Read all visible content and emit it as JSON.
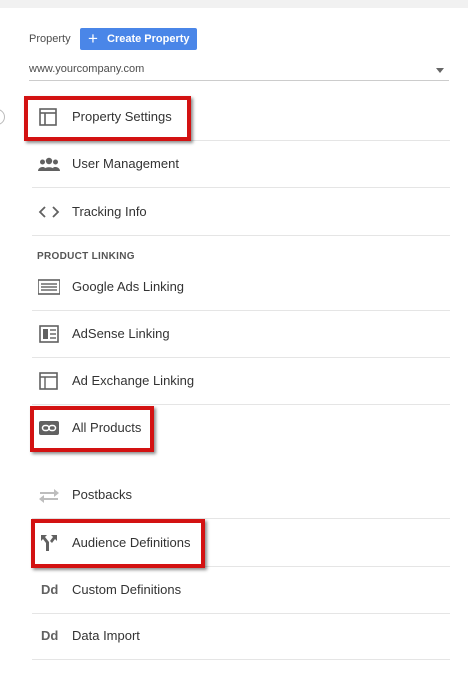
{
  "property": {
    "label": "Property",
    "create_button": "Create Property",
    "selected": "www.yourcompany.com"
  },
  "menu": [
    {
      "label": "Property Settings",
      "icon": "layout-icon",
      "highlighted": true
    },
    {
      "label": "User Management",
      "icon": "people-icon"
    },
    {
      "label": "Tracking Info",
      "icon": "code-icon"
    }
  ],
  "section_header": "PRODUCT LINKING",
  "linking": [
    {
      "label": "Google Ads Linking",
      "icon": "ads-icon"
    },
    {
      "label": "AdSense Linking",
      "icon": "adsense-icon"
    },
    {
      "label": "Ad Exchange Linking",
      "icon": "ad-exchange-icon"
    },
    {
      "label": "All Products",
      "icon": "link-icon",
      "highlighted": true
    }
  ],
  "other": [
    {
      "label": "Postbacks",
      "icon": "postbacks-icon"
    },
    {
      "label": "Audience Definitions",
      "icon": "audience-icon",
      "highlighted": true
    },
    {
      "label": "Custom Definitions",
      "icon": "dd-icon",
      "icon_text": "Dd"
    },
    {
      "label": "Data Import",
      "icon": "dd-icon",
      "icon_text": "Dd"
    }
  ],
  "colors": {
    "accent": "#4a86e8",
    "highlight": "#d31212",
    "icon": "#616161"
  }
}
